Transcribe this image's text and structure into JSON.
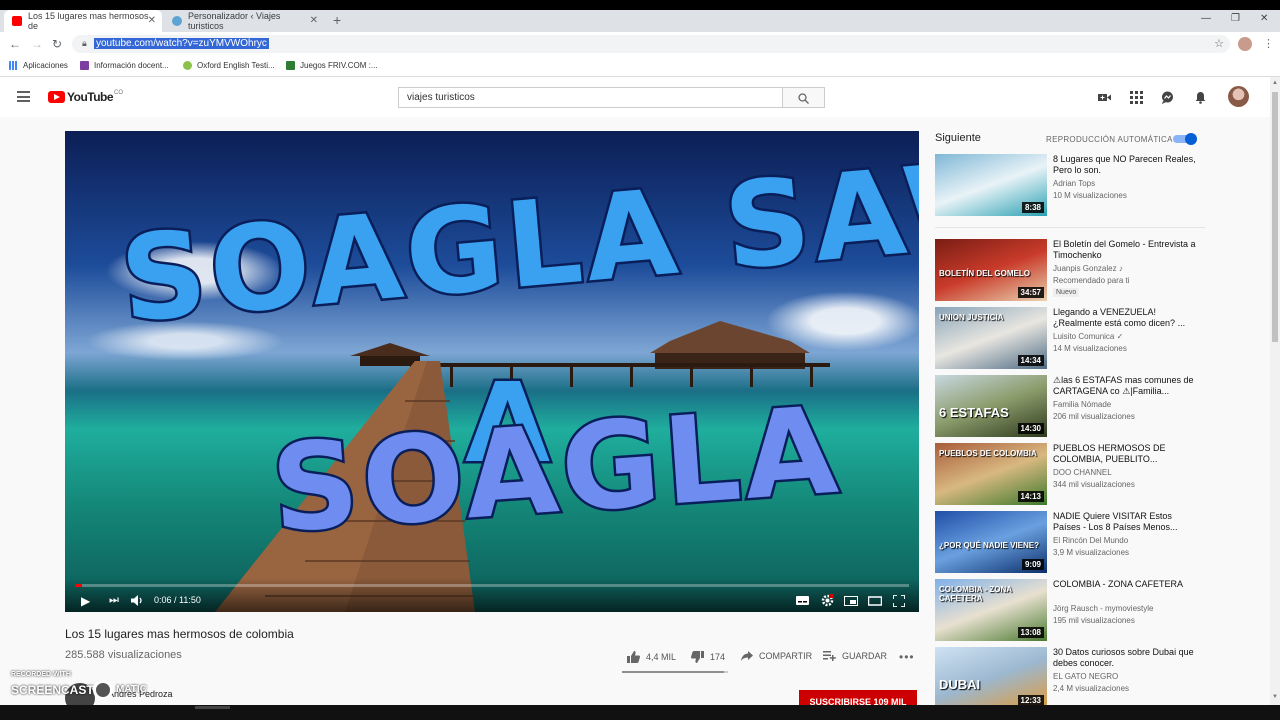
{
  "browser": {
    "tabs": [
      {
        "title": "Los 15 lugares mas hermosos de"
      },
      {
        "title": "Personalizador ‹ Viajes turisticos"
      }
    ],
    "new_tab": "+",
    "url": "youtube.com/watch?v=zuYMVWOhryc",
    "bookmarks": [
      "Aplicaciones",
      "Información docent...",
      "Oxford English Testi...",
      "Juegos FRIV.COM :..."
    ]
  },
  "youtube": {
    "logo_text": "YouTube",
    "logo_region": "CO",
    "search_value": "viajes turisticos"
  },
  "player": {
    "overlay_lines": [
      "SOAGLA SAW",
      "A",
      "SOAGLA"
    ],
    "time": "0:06 / 11:50",
    "progress": 0.0085
  },
  "video": {
    "title": "Los 15 lugares mas hermosos de colombia",
    "views": "285.588 visualizaciones",
    "likes": "4,4 MIL",
    "dislikes": "174",
    "share": "COMPARTIR",
    "save": "GUARDAR",
    "like_ratio": 0.96,
    "channel": "Andres Pedroza",
    "subscribe": "SUSCRIBIRSE  109 MIL"
  },
  "watermark": {
    "line1": "RECORDED WITH",
    "line2": "SCREENCAST",
    "line3": "MATIC"
  },
  "sidebar": {
    "up_next": "Siguiente",
    "autoplay": "REPRODUCCIÓN AUTOMÁTICA",
    "autoplay_on": true,
    "items": [
      {
        "title": "8 Lugares que NO Parecen Reales, Pero lo son.",
        "channel": "Adrian Tops",
        "views": "10 M visualizaciones",
        "duration": "8:38",
        "thumb_text": "",
        "colors": [
          "#7fb7d6",
          "#e9f3f7",
          "#2aa0b3"
        ]
      },
      {
        "title": "El Boletín del Gomelo - Entrevista a Timochenko",
        "channel": "Juanpis Gonzalez ♪",
        "views": "Recomendado para ti",
        "duration": "34:57",
        "badge": "Nuevo",
        "thumb_text": "BOLETÍN DEL GOMELO",
        "colors": [
          "#7a1d14",
          "#c93b2a",
          "#e9d3b0"
        ]
      },
      {
        "title": "Llegando a VENEZUELA! ¿Realmente está como dicen? ...",
        "channel": "Luisito Comunica ✓",
        "views": "14 M visualizaciones",
        "duration": "14:34",
        "thumb_text": "UNION JUSTICIA",
        "colors": [
          "#88a3b8",
          "#e8e6e0",
          "#4e6b85"
        ]
      },
      {
        "title": "⚠las 6 ESTAFAS mas comunes de CARTAGENA co ⚠|Familia...",
        "channel": "Familia Nómade",
        "views": "206 mil visualizaciones",
        "duration": "14:30",
        "thumb_text": "6 ESTAFAS",
        "colors": [
          "#c8d8e0",
          "#8a9b6a",
          "#2e3a1e"
        ]
      },
      {
        "title": "PUEBLOS HERMOSOS DE COLOMBIA, PUEBLITO...",
        "channel": "DOO CHANNEL",
        "views": "344 mil visualizaciones",
        "duration": "14:13",
        "thumb_text": "PUEBLOS DE COLOMBIA",
        "colors": [
          "#a85c3a",
          "#d8b880",
          "#3d7a2c"
        ]
      },
      {
        "title": "NADIE Quiere VISITAR Estos Países - Los 8 Países Menos...",
        "channel": "El Rincón Del Mundo",
        "views": "3,9 M visualizaciones",
        "duration": "9:09",
        "thumb_text": "¿POR QUÉ NADIE VIENE?",
        "colors": [
          "#1f4fa8",
          "#6aa0e0",
          "#0c2f6a"
        ]
      },
      {
        "title": "COLOMBIA - ZONA CAFETERA",
        "channel": "Jörg Rausch - mymoviestyle",
        "views": "195 mil visualizaciones",
        "duration": "13:08",
        "thumb_text": "COLOMBIA - ZONA CAFETERA",
        "colors": [
          "#7fb0e8",
          "#e8e0d0",
          "#4a7a30"
        ]
      },
      {
        "title": "30 Datos curiosos sobre Dubai que debes conocer.",
        "channel": "EL GATO NEGRO",
        "views": "2,4 M visualizaciones",
        "duration": "12:33",
        "thumb_text": "DUBAI",
        "colors": [
          "#cfe2f3",
          "#9cb8d0",
          "#e09a3a"
        ]
      }
    ]
  }
}
